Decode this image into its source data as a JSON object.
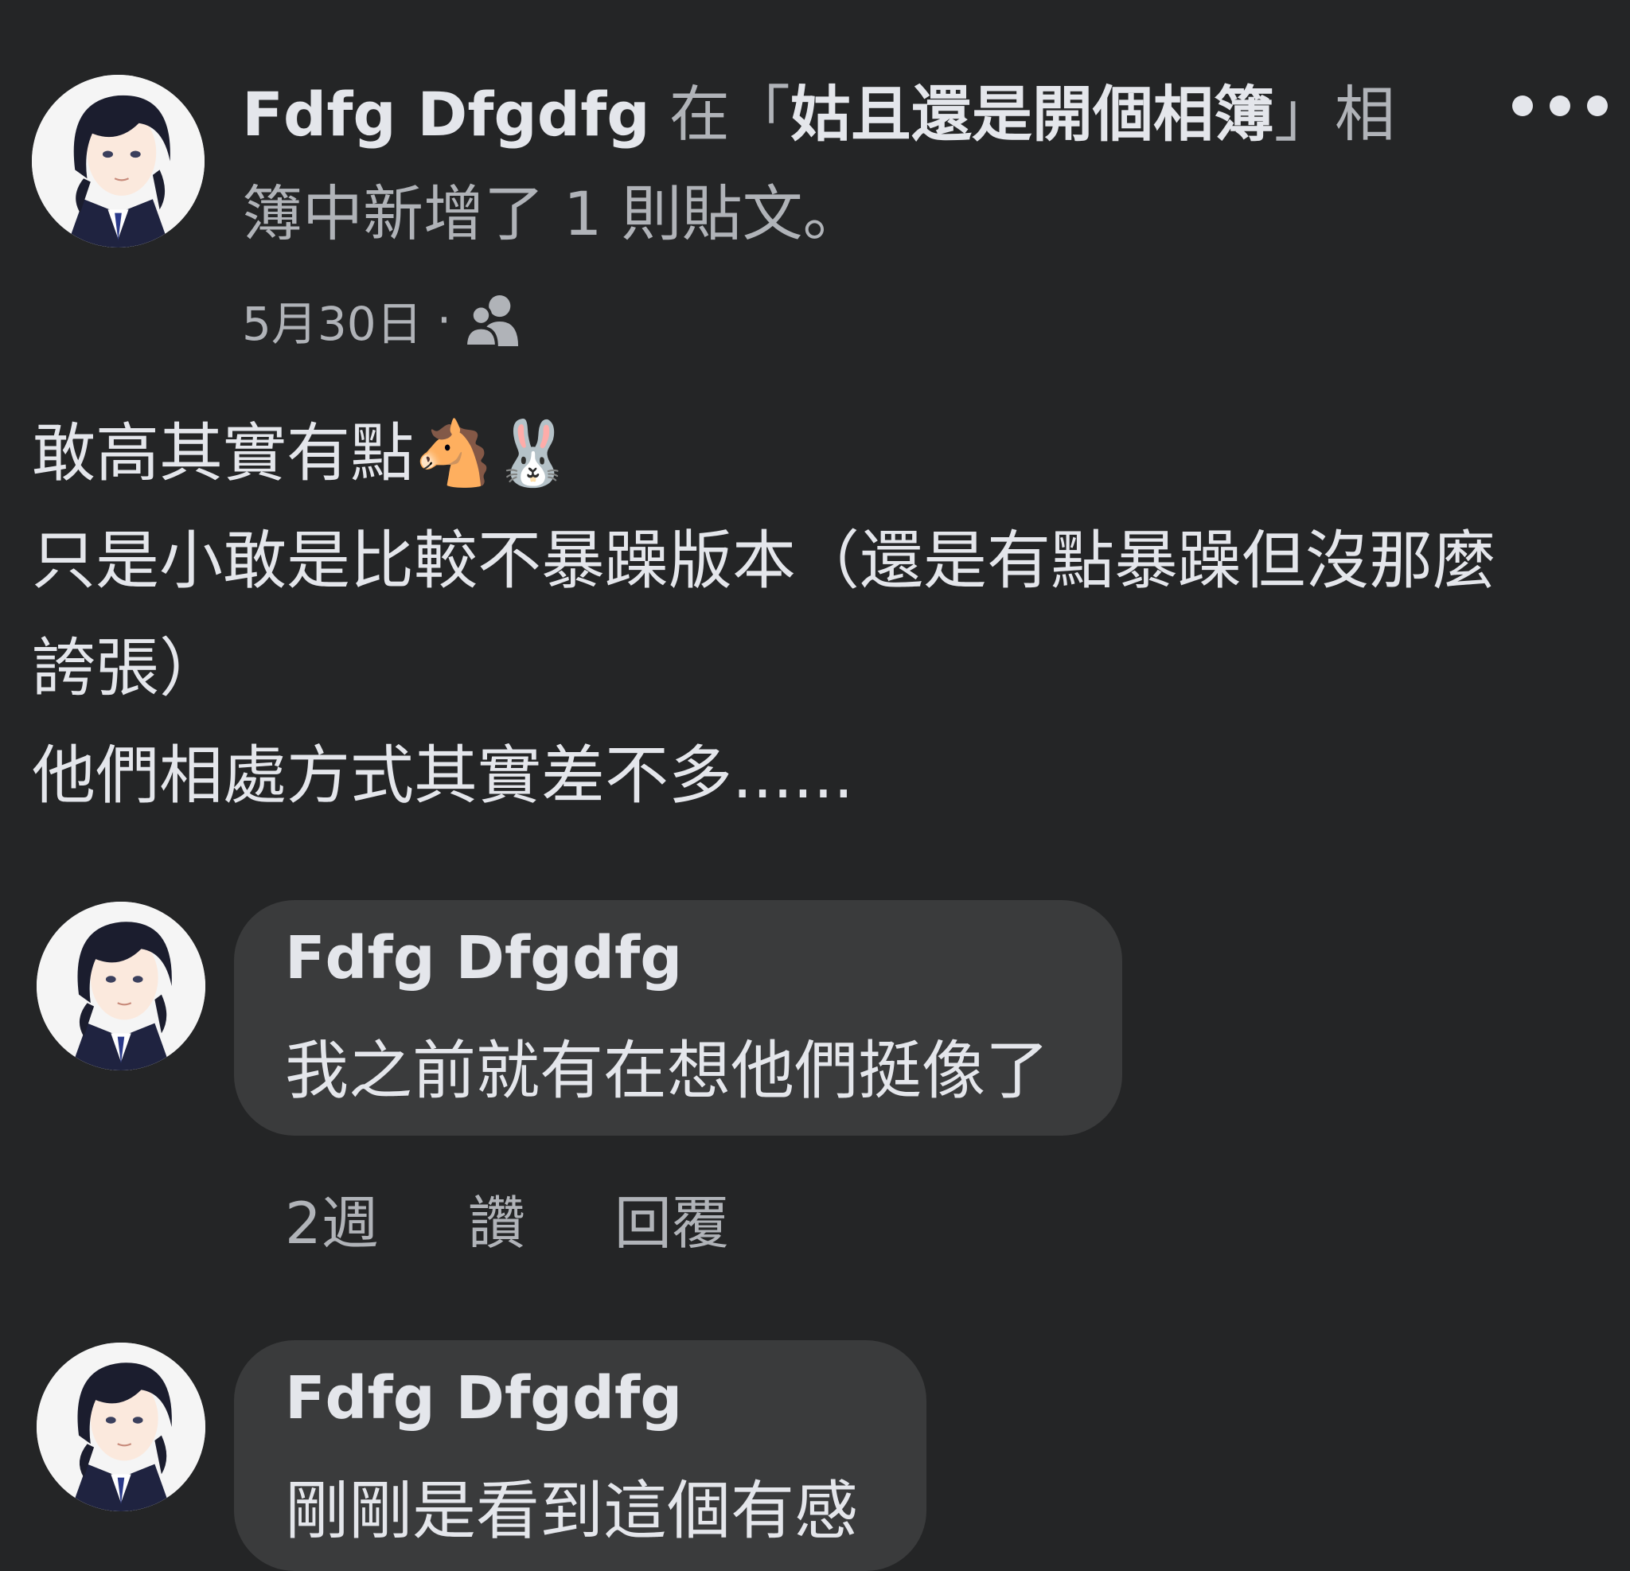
{
  "post": {
    "author": "Fdfg Dfgdfg",
    "header_in": "在「",
    "album_name": "姑且還是開個相簿",
    "header_close": "」相",
    "header_line2": "簿中新增了 1 則貼文。",
    "date": "5月30日",
    "separator": "·",
    "audience_icon": "friends-icon",
    "more_icon": "more-horizontal-icon",
    "body_lines": [
      "敢高其實有點🐴🐰",
      "只是小敢是比較不暴躁版本（還是有點暴躁但沒那麼",
      "誇張）",
      "他們相處方式其實差不多......"
    ]
  },
  "comments": [
    {
      "author": "Fdfg Dfgdfg",
      "text": "我之前就有在想他們挺像了",
      "time": "2週",
      "like_label": "讚",
      "reply_label": "回覆"
    },
    {
      "author": "Fdfg Dfgdfg",
      "text": "剛剛是看到這個有感"
    }
  ],
  "colors": {
    "background": "#242526",
    "bubble": "#3a3b3c",
    "primary_text": "#e4e6eb",
    "secondary_text": "#b0b3b8"
  }
}
